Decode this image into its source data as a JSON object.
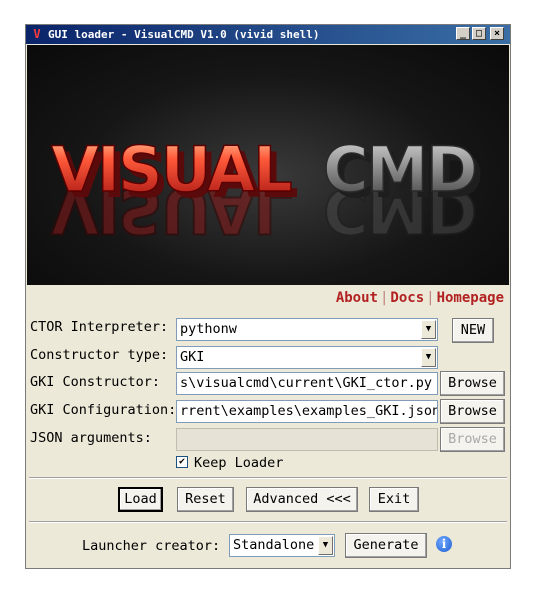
{
  "window": {
    "title": "GUI loader - VisualCMD V1.0 (vivid shell)",
    "app_icon": "v-logo-icon",
    "controls": [
      "minimize",
      "maximize",
      "close"
    ]
  },
  "banner": {
    "logo_word1": "VISUAL",
    "logo_word2": "CMD"
  },
  "links": {
    "about": "About",
    "docs": "Docs",
    "homepage": "Homepage"
  },
  "form": {
    "interpreter_label": "CTOR Interpreter:",
    "interpreter_value": "pythonw",
    "new_button": "NEW",
    "ctor_type_label": "Constructor type:",
    "ctor_type_value": "GKI",
    "gki_ctor_label": "GKI Constructor:",
    "gki_ctor_value": "s\\visualcmd\\current\\GKI_ctor.py",
    "gki_config_label": "GKI Configuration:",
    "gki_config_value": "rrent\\examples\\examples_GKI.json",
    "json_args_label": "JSON arguments:",
    "json_args_value": "",
    "browse_label": "Browse",
    "keep_loader_label": "Keep Loader",
    "keep_loader_checked": true
  },
  "actions": {
    "load": "Load",
    "reset": "Reset",
    "advanced": "Advanced <<<",
    "exit": "Exit"
  },
  "launcher": {
    "label": "Launcher creator:",
    "value": "Standalone",
    "generate": "Generate"
  },
  "colors": {
    "link": "#b22222",
    "titlebar": "#0a246a",
    "window_bg": "#ece9d8"
  }
}
